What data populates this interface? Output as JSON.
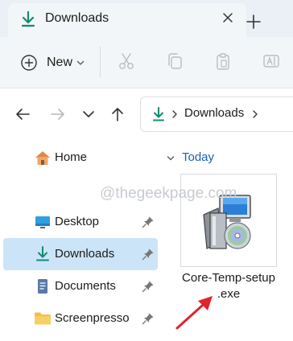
{
  "window": {
    "tab_title": "Downloads",
    "tab_icon": "download-icon",
    "close_icon": "close-icon",
    "new_tab_icon": "plus-icon"
  },
  "toolbar": {
    "new_label": "New",
    "new_icon": "plus-circle-icon",
    "icons": [
      "cut-icon",
      "copy-icon",
      "paste-icon",
      "rename-icon"
    ]
  },
  "navigation": {
    "back_icon": "arrow-left-icon",
    "forward_icon": "arrow-right-icon",
    "recent_icon": "chevron-down-icon",
    "up_icon": "arrow-up-icon",
    "address": {
      "icon": "download-icon",
      "segments": [
        "Downloads"
      ]
    }
  },
  "sidebar": {
    "items": [
      {
        "label": "Home",
        "icon": "home-icon",
        "pinned": false,
        "selected": false
      },
      {
        "label": "Desktop",
        "icon": "desktop-icon",
        "pinned": true,
        "selected": false
      },
      {
        "label": "Downloads",
        "icon": "download-icon",
        "pinned": true,
        "selected": true
      },
      {
        "label": "Documents",
        "icon": "documents-icon",
        "pinned": true,
        "selected": false
      },
      {
        "label": "Screenpresso",
        "icon": "folder-icon",
        "pinned": true,
        "selected": false
      }
    ]
  },
  "content": {
    "group_label": "Today",
    "files": [
      {
        "name_line1": "Core-Temp-setup",
        "name_line2": ".exe",
        "icon": "installer-icon"
      }
    ]
  },
  "overlay": {
    "watermark": "@thegeekpage.com",
    "arrow_color": "#e0242c"
  },
  "colors": {
    "accent": "#1a5fb4",
    "selected_bg": "#cce4f7",
    "download_green": "#138a72",
    "folder_yellow": "#f2c04a"
  }
}
